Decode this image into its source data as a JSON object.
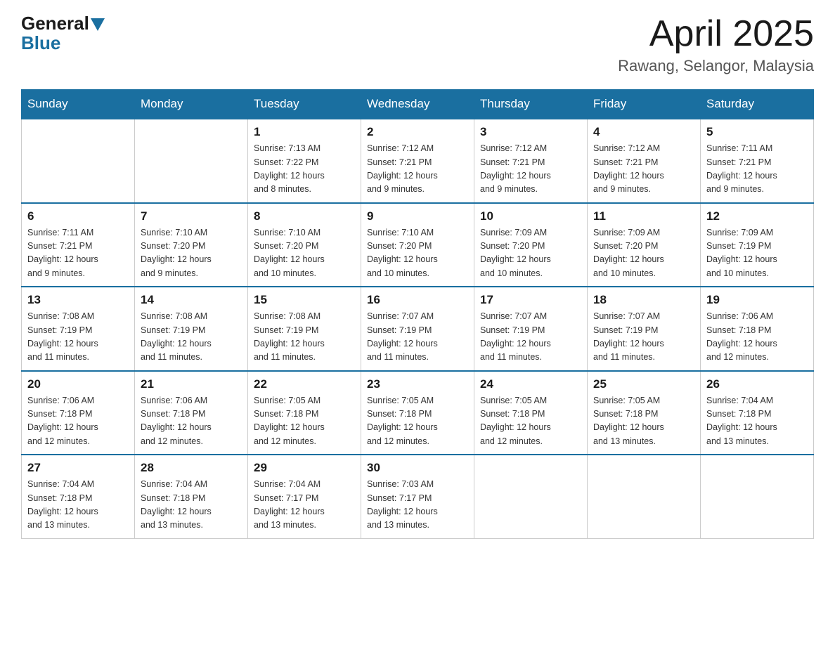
{
  "header": {
    "logo_general": "General",
    "logo_blue": "Blue",
    "month_title": "April 2025",
    "location": "Rawang, Selangor, Malaysia"
  },
  "days_of_week": [
    "Sunday",
    "Monday",
    "Tuesday",
    "Wednesday",
    "Thursday",
    "Friday",
    "Saturday"
  ],
  "weeks": [
    [
      {
        "day": "",
        "info": ""
      },
      {
        "day": "",
        "info": ""
      },
      {
        "day": "1",
        "info": "Sunrise: 7:13 AM\nSunset: 7:22 PM\nDaylight: 12 hours\nand 8 minutes."
      },
      {
        "day": "2",
        "info": "Sunrise: 7:12 AM\nSunset: 7:21 PM\nDaylight: 12 hours\nand 9 minutes."
      },
      {
        "day": "3",
        "info": "Sunrise: 7:12 AM\nSunset: 7:21 PM\nDaylight: 12 hours\nand 9 minutes."
      },
      {
        "day": "4",
        "info": "Sunrise: 7:12 AM\nSunset: 7:21 PM\nDaylight: 12 hours\nand 9 minutes."
      },
      {
        "day": "5",
        "info": "Sunrise: 7:11 AM\nSunset: 7:21 PM\nDaylight: 12 hours\nand 9 minutes."
      }
    ],
    [
      {
        "day": "6",
        "info": "Sunrise: 7:11 AM\nSunset: 7:21 PM\nDaylight: 12 hours\nand 9 minutes."
      },
      {
        "day": "7",
        "info": "Sunrise: 7:10 AM\nSunset: 7:20 PM\nDaylight: 12 hours\nand 9 minutes."
      },
      {
        "day": "8",
        "info": "Sunrise: 7:10 AM\nSunset: 7:20 PM\nDaylight: 12 hours\nand 10 minutes."
      },
      {
        "day": "9",
        "info": "Sunrise: 7:10 AM\nSunset: 7:20 PM\nDaylight: 12 hours\nand 10 minutes."
      },
      {
        "day": "10",
        "info": "Sunrise: 7:09 AM\nSunset: 7:20 PM\nDaylight: 12 hours\nand 10 minutes."
      },
      {
        "day": "11",
        "info": "Sunrise: 7:09 AM\nSunset: 7:20 PM\nDaylight: 12 hours\nand 10 minutes."
      },
      {
        "day": "12",
        "info": "Sunrise: 7:09 AM\nSunset: 7:19 PM\nDaylight: 12 hours\nand 10 minutes."
      }
    ],
    [
      {
        "day": "13",
        "info": "Sunrise: 7:08 AM\nSunset: 7:19 PM\nDaylight: 12 hours\nand 11 minutes."
      },
      {
        "day": "14",
        "info": "Sunrise: 7:08 AM\nSunset: 7:19 PM\nDaylight: 12 hours\nand 11 minutes."
      },
      {
        "day": "15",
        "info": "Sunrise: 7:08 AM\nSunset: 7:19 PM\nDaylight: 12 hours\nand 11 minutes."
      },
      {
        "day": "16",
        "info": "Sunrise: 7:07 AM\nSunset: 7:19 PM\nDaylight: 12 hours\nand 11 minutes."
      },
      {
        "day": "17",
        "info": "Sunrise: 7:07 AM\nSunset: 7:19 PM\nDaylight: 12 hours\nand 11 minutes."
      },
      {
        "day": "18",
        "info": "Sunrise: 7:07 AM\nSunset: 7:19 PM\nDaylight: 12 hours\nand 11 minutes."
      },
      {
        "day": "19",
        "info": "Sunrise: 7:06 AM\nSunset: 7:18 PM\nDaylight: 12 hours\nand 12 minutes."
      }
    ],
    [
      {
        "day": "20",
        "info": "Sunrise: 7:06 AM\nSunset: 7:18 PM\nDaylight: 12 hours\nand 12 minutes."
      },
      {
        "day": "21",
        "info": "Sunrise: 7:06 AM\nSunset: 7:18 PM\nDaylight: 12 hours\nand 12 minutes."
      },
      {
        "day": "22",
        "info": "Sunrise: 7:05 AM\nSunset: 7:18 PM\nDaylight: 12 hours\nand 12 minutes."
      },
      {
        "day": "23",
        "info": "Sunrise: 7:05 AM\nSunset: 7:18 PM\nDaylight: 12 hours\nand 12 minutes."
      },
      {
        "day": "24",
        "info": "Sunrise: 7:05 AM\nSunset: 7:18 PM\nDaylight: 12 hours\nand 12 minutes."
      },
      {
        "day": "25",
        "info": "Sunrise: 7:05 AM\nSunset: 7:18 PM\nDaylight: 12 hours\nand 13 minutes."
      },
      {
        "day": "26",
        "info": "Sunrise: 7:04 AM\nSunset: 7:18 PM\nDaylight: 12 hours\nand 13 minutes."
      }
    ],
    [
      {
        "day": "27",
        "info": "Sunrise: 7:04 AM\nSunset: 7:18 PM\nDaylight: 12 hours\nand 13 minutes."
      },
      {
        "day": "28",
        "info": "Sunrise: 7:04 AM\nSunset: 7:18 PM\nDaylight: 12 hours\nand 13 minutes."
      },
      {
        "day": "29",
        "info": "Sunrise: 7:04 AM\nSunset: 7:17 PM\nDaylight: 12 hours\nand 13 minutes."
      },
      {
        "day": "30",
        "info": "Sunrise: 7:03 AM\nSunset: 7:17 PM\nDaylight: 12 hours\nand 13 minutes."
      },
      {
        "day": "",
        "info": ""
      },
      {
        "day": "",
        "info": ""
      },
      {
        "day": "",
        "info": ""
      }
    ]
  ]
}
